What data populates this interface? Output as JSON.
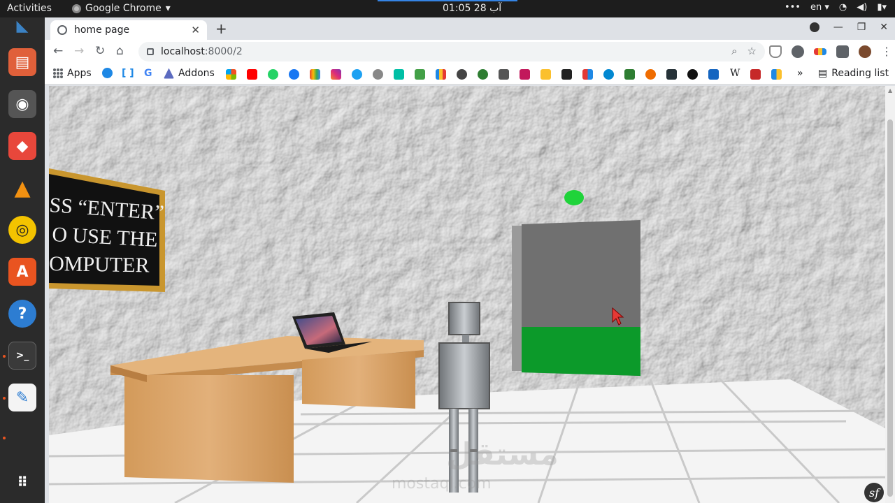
{
  "os": {
    "activities": "Activities",
    "app_name": "Google Chrome",
    "clock": "01:05  28 آب",
    "lang": "en"
  },
  "browser": {
    "tab_title": "home page",
    "url_host": "localhost",
    "url_path": ":8000/2",
    "bookmarks": {
      "apps": "Apps",
      "addons": "Addons",
      "reading_list": "Reading list",
      "overflow": "»"
    }
  },
  "scene": {
    "sign_lines": [
      "SS “ENTER”",
      "O USE THE",
      "OMPUTER"
    ],
    "colors": {
      "wall": "#e2e2e2",
      "floor": "#f4f4f4",
      "desk": "#d9a667",
      "door": "#707070",
      "grass": "#0c9a2a",
      "light": "#1fd33a",
      "frame": "#c9962e",
      "board": "#111111"
    }
  },
  "watermark": {
    "arabic": "مستقل",
    "latin": "mostaql.com"
  }
}
